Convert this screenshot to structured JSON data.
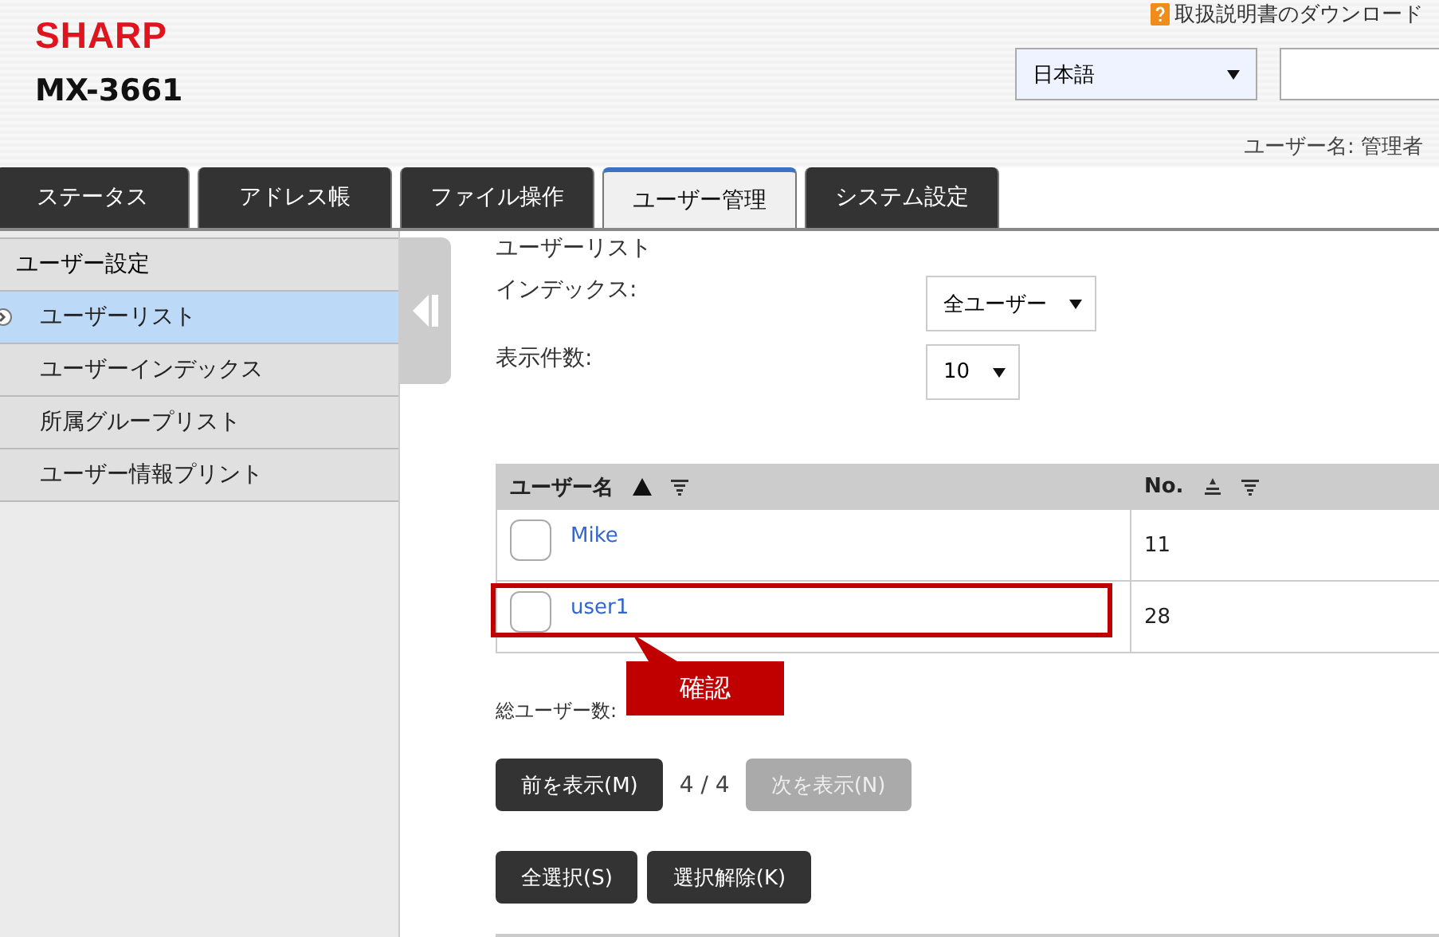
{
  "header": {
    "logo": "SHARP",
    "model": "MX-3661",
    "manual_link": "取扱説明書のダウンロード",
    "language": "日本語",
    "user_label": "ユーザー名: 管理者"
  },
  "tabs": [
    {
      "label": "ステータス",
      "selected": false
    },
    {
      "label": "アドレス帳",
      "selected": false
    },
    {
      "label": "ファイル操作",
      "selected": false
    },
    {
      "label": "ユーザー管理",
      "selected": true
    },
    {
      "label": "システム設定",
      "selected": false
    }
  ],
  "sidebar": {
    "heading": "ユーザー設定",
    "items": [
      {
        "label": "ユーザーリスト",
        "selected": true
      },
      {
        "label": "ユーザーインデックス",
        "selected": false
      },
      {
        "label": "所属グループリスト",
        "selected": false
      },
      {
        "label": "ユーザー情報プリント",
        "selected": false
      }
    ]
  },
  "main": {
    "title": "ユーザーリスト",
    "filters": [
      {
        "label": "インデックス:",
        "value": "全ユーザー"
      },
      {
        "label": "表示件数:",
        "value": "10"
      }
    ],
    "table": {
      "columns": [
        {
          "label": "ユーザー名",
          "sorted": true
        },
        {
          "label": "No.",
          "sorted": false
        }
      ],
      "rows": [
        {
          "name": "Mike",
          "no": "11",
          "checked": false,
          "highlighted": false
        },
        {
          "name": "user1",
          "no": "28",
          "checked": false,
          "highlighted": true
        }
      ]
    },
    "total_label": "総ユーザー数:",
    "callout": "確認",
    "pager": {
      "prev": {
        "label": "前を表示(M)",
        "disabled": false
      },
      "page": "4 / 4",
      "next": {
        "label": "次を表示(N)",
        "disabled": true
      }
    },
    "select_buttons": [
      "全選択(S)",
      "選択解除(K)"
    ]
  }
}
